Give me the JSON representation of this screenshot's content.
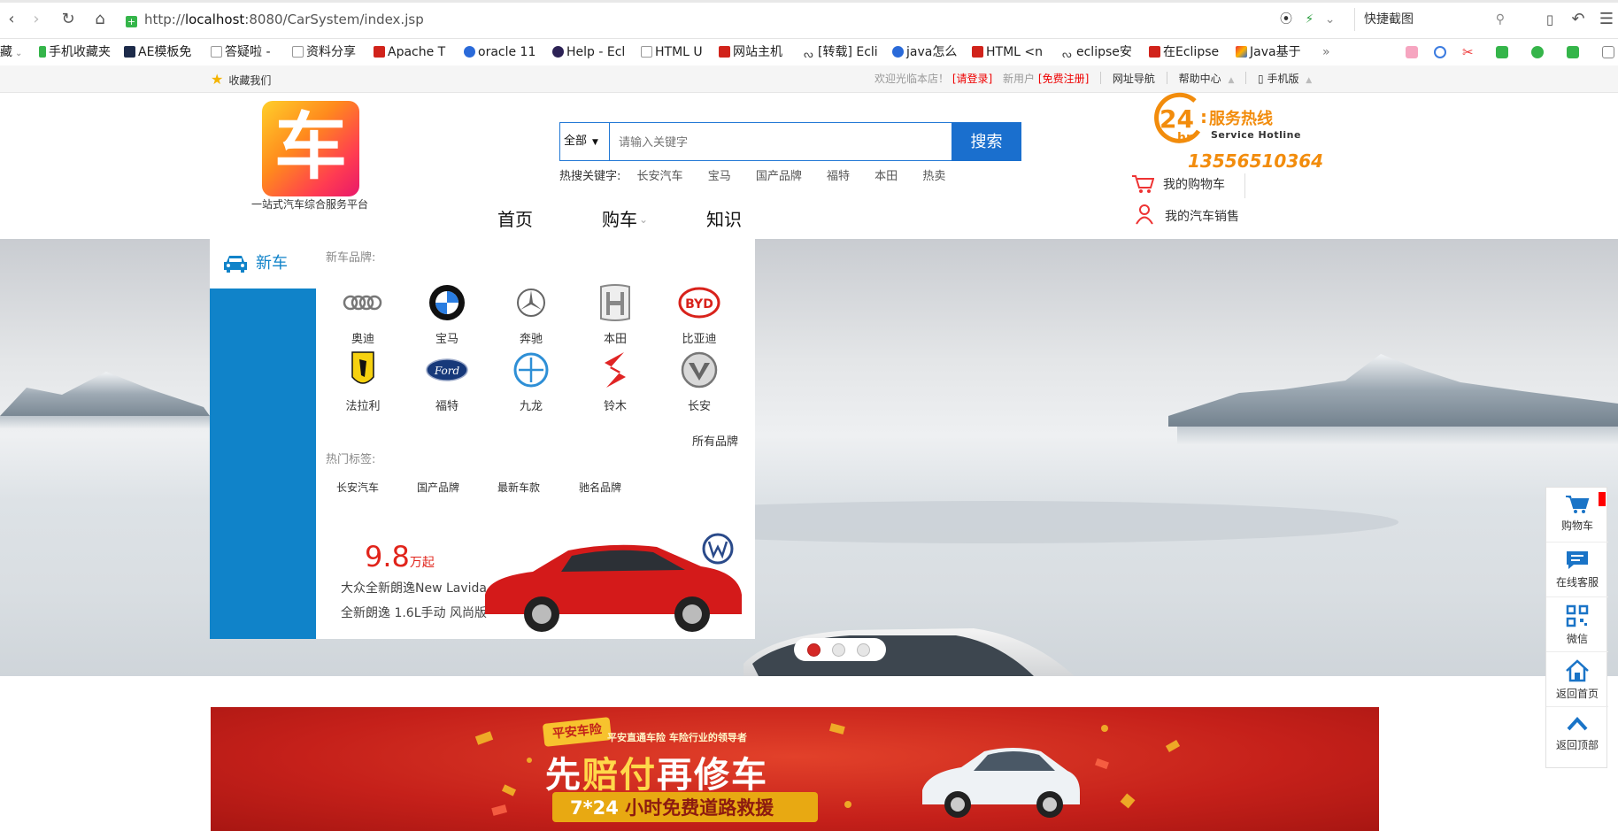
{
  "browser": {
    "url_prefix": "http://",
    "url_host": "localhost",
    "url_rest": ":8080/CarSystem/index.jsp",
    "shortcut_label": "快捷截图"
  },
  "bookmarks": [
    "藏",
    "手机收藏夹",
    "AE模板免",
    "答疑啦 -",
    "资料分享",
    "Apache T",
    "oracle 11",
    "Help - Ecl",
    "HTML U",
    "网站主机",
    "[转载] Ecli",
    "java怎么",
    "HTML <n",
    "eclipse安",
    "在Eclipse",
    "Java基于"
  ],
  "bookmarks_more": "»",
  "topbar": {
    "favorite": "收藏我们",
    "welcome": "欢迎光临本店！",
    "login": "[请登录]",
    "new_user": "新用户",
    "register": "[免费注册]",
    "site_nav": "网址导航",
    "help": "帮助中心",
    "mobile": "手机版"
  },
  "header": {
    "logo_char": "车",
    "logo_caption": "一站式汽车综合服务平台",
    "search_category": "全部",
    "search_placeholder": "请输入关键字",
    "search_button": "搜索",
    "hot_label": "热搜关键字:",
    "hot_keywords": [
      "长安汽车",
      "宝马",
      "国产品牌",
      "福特",
      "本田",
      "热卖"
    ],
    "hotline_24": "24",
    "hotline_hr": "hr",
    "hotline_title": "服务热线",
    "hotline_en": "Service Hotline",
    "hotline_number": "13556510364",
    "cart": "我的购物车",
    "sales": "我的汽车销售"
  },
  "nav": [
    "首页",
    "购车",
    "知识"
  ],
  "category_menu": {
    "head": "新车",
    "brand_label": "新车品牌:",
    "brands": [
      "奥迪",
      "宝马",
      "奔驰",
      "本田",
      "比亚迪",
      "法拉利",
      "福特",
      "九龙",
      "铃木",
      "长安"
    ],
    "all_brands": "所有品牌",
    "hot_tags_label": "热门标签:",
    "hot_tags": [
      "长安汽车",
      "国产品牌",
      "最新车款",
      "驰名品牌"
    ],
    "promo_price": "9.8",
    "promo_unit": "万起",
    "promo_title": "大众全新朗逸New Lavida",
    "promo_sub": "全新朗逸 1.6L手动 风尚版"
  },
  "carousel": {
    "slides": 3,
    "active_index": 0
  },
  "insurance": {
    "badge": "平安车险",
    "sub": "平安直通车险 车险行业的领导者",
    "title_a": "先",
    "title_b": "赔付",
    "title_c": "再修车",
    "bottom_a": "7*24",
    "bottom_b": " 小时免费道路救援"
  },
  "float_bar": [
    "购物车",
    "在线客服",
    "微信",
    "返回首页",
    "返回顶部"
  ],
  "colors": {
    "accent_blue": "#1083c9",
    "search_blue": "#1a6fce",
    "hotline_orange": "#f28c0c",
    "promo_red": "#e1241b"
  }
}
